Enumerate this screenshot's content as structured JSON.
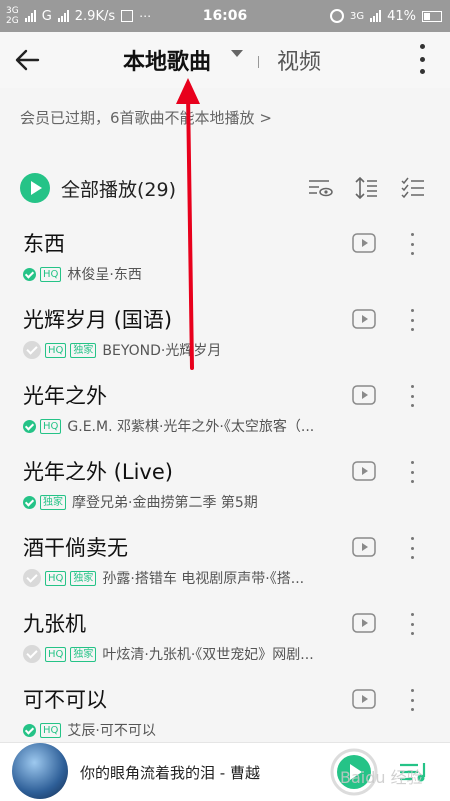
{
  "status_bar": {
    "net_top": "3G",
    "net_bottom": "2G",
    "carrier": "G",
    "speed": "2.9K/s",
    "time": "16:06",
    "net_right": "3G",
    "battery": "41%"
  },
  "header": {
    "title": "本地歌曲",
    "video_tab": "视频"
  },
  "notice": "会员已过期，6首歌曲不能本地播放 >",
  "play_all": {
    "label": "全部播放(29)"
  },
  "songs": [
    {
      "title": "东西",
      "downloaded": true,
      "tags": [
        "HQ"
      ],
      "artist": "林俊呈·东西"
    },
    {
      "title": "光辉岁月 (国语)",
      "downloaded": false,
      "tags": [
        "HQ",
        "独家"
      ],
      "artist": "BEYOND·光辉岁月"
    },
    {
      "title": "光年之外",
      "downloaded": true,
      "tags": [
        "HQ"
      ],
      "artist": "G.E.M. 邓紫棋·光年之外·《太空旅客（..."
    },
    {
      "title": "光年之外 (Live)",
      "downloaded": true,
      "tags": [
        "独家"
      ],
      "artist": "摩登兄弟·金曲捞第二季 第5期"
    },
    {
      "title": "酒干倘卖无",
      "downloaded": false,
      "tags": [
        "HQ",
        "独家"
      ],
      "artist": "孙露·搭错车 电视剧原声带·《搭..."
    },
    {
      "title": "九张机",
      "downloaded": false,
      "tags": [
        "HQ",
        "独家"
      ],
      "artist": "叶炫清·九张机·《双世宠妃》网剧..."
    },
    {
      "title": "可不可以",
      "downloaded": true,
      "tags": [
        "HQ"
      ],
      "artist": "艾辰·可不可以"
    }
  ],
  "player": {
    "now_playing": "你的眼角流着我的泪 - 曹越"
  },
  "watermark": "Baidu 经验",
  "colors": {
    "accent": "#25c387",
    "arrow": "#e8001c",
    "status_bar": "#9a9a9a"
  }
}
